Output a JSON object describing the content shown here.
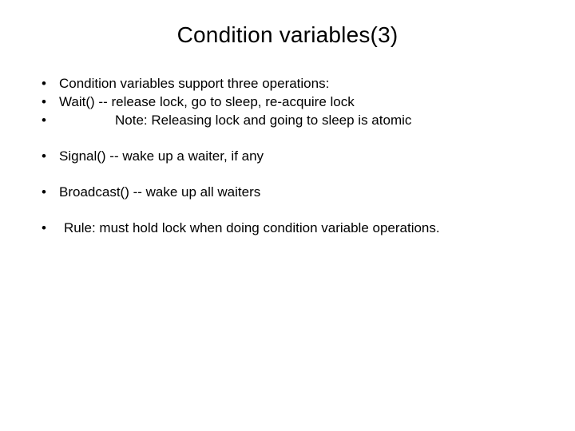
{
  "title": "Condition variables(3)",
  "bullets": {
    "b1": "Condition variables support three operations:",
    "b2": "Wait() -- release lock,  go to sleep, re-acquire lock",
    "b3": "Note: Releasing lock and going to sleep is atomic",
    "b4": "Signal() -- wake up a waiter, if any",
    "b5": "Broadcast() -- wake up all waiters",
    "b6": "Rule: must hold lock when doing condition variable operations."
  }
}
